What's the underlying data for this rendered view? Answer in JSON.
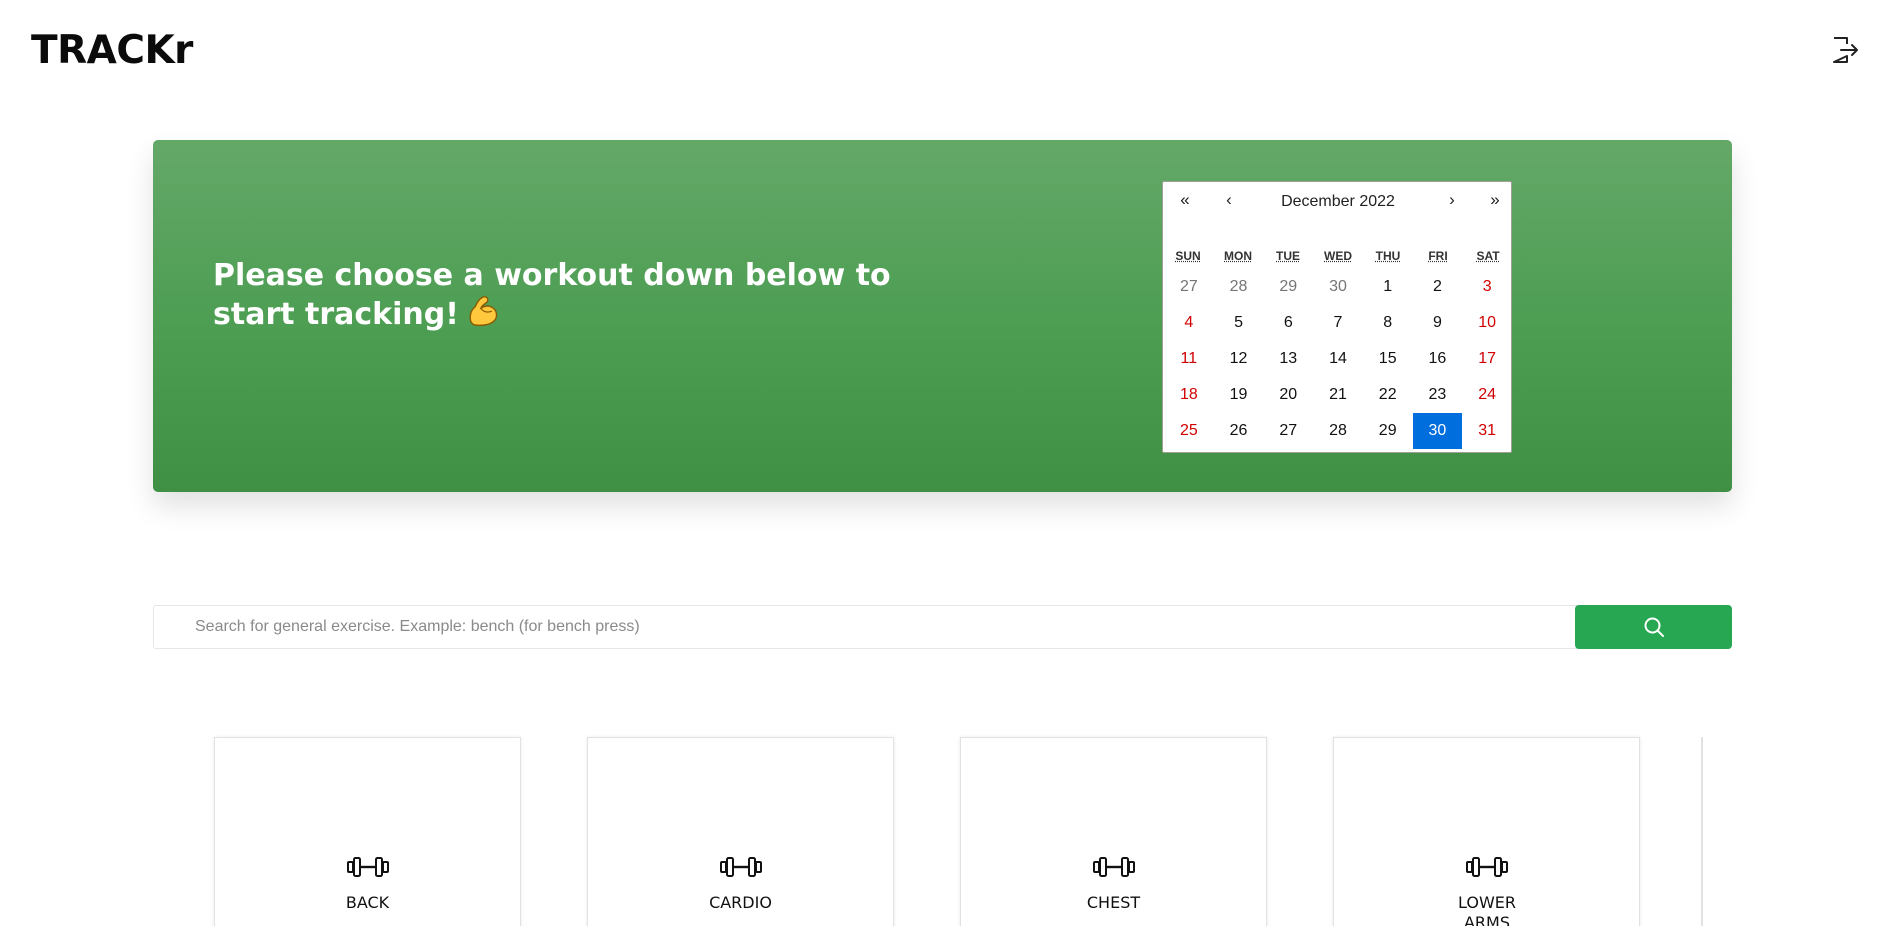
{
  "header": {
    "logo": "TRACKr",
    "logout_icon": "logout-icon"
  },
  "hero": {
    "message": "Please choose a workout down below to start tracking!",
    "emoji_icon": "flexed-biceps-icon",
    "colors": {
      "background": "#4c9d52",
      "text": "#ffffff"
    }
  },
  "calendar": {
    "label": "December 2022",
    "nav": {
      "prev2": "«",
      "prev": "‹",
      "next": "›",
      "next2": "»"
    },
    "weekdays": [
      "SUN",
      "MON",
      "TUE",
      "WED",
      "THU",
      "FRI",
      "SAT"
    ],
    "days": [
      "27",
      "28",
      "29",
      "30",
      "1",
      "2",
      "3",
      "4",
      "5",
      "6",
      "7",
      "8",
      "9",
      "10",
      "11",
      "12",
      "13",
      "14",
      "15",
      "16",
      "17",
      "18",
      "19",
      "20",
      "21",
      "22",
      "23",
      "24",
      "25",
      "26",
      "27",
      "28",
      "29",
      "30",
      "31"
    ],
    "selected_day": "30",
    "colors": {
      "selected": "#006edc",
      "weekend": "#d10000",
      "neighbor": "#757575"
    }
  },
  "search": {
    "placeholder": "Search for general exercise. Example: bench (for bench press)",
    "value": "",
    "button_icon": "search-icon",
    "button_color": "#28a752"
  },
  "categories": [
    {
      "label": "BACK",
      "icon": "dumbbell-icon"
    },
    {
      "label": "CARDIO",
      "icon": "dumbbell-icon"
    },
    {
      "label": "CHEST",
      "icon": "dumbbell-icon"
    },
    {
      "label": "LOWER ARMS",
      "icon": "dumbbell-icon"
    }
  ]
}
